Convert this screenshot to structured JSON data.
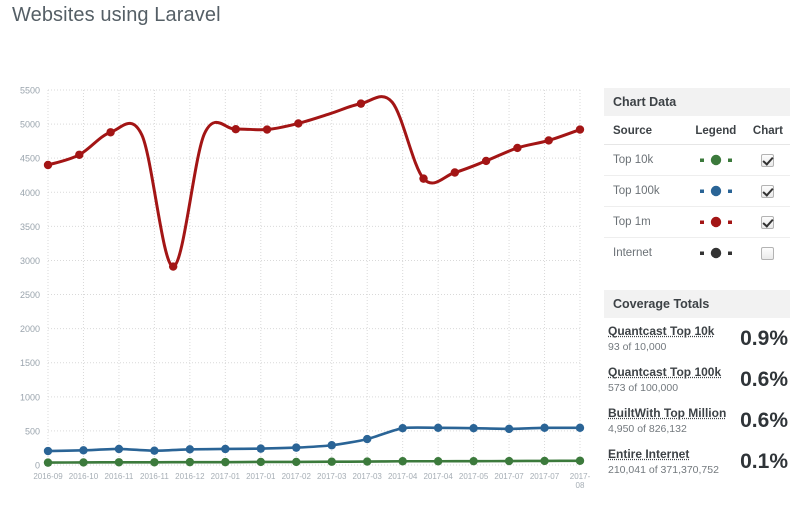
{
  "page_title": "Websites using Laravel",
  "chart_panel": {
    "colors": {
      "top10k": "#3c7a3c",
      "top100k": "#2a6496",
      "top1m": "#a31515",
      "internet": "#333333",
      "grid": "#dddddd",
      "axis_text": "#9aa4ad"
    }
  },
  "chart_data": {
    "type": "line",
    "title": "Websites using Laravel",
    "xlabel": "",
    "ylabel": "",
    "ylim": [
      0,
      5500
    ],
    "ytick_step": 500,
    "grid": true,
    "legend_position": "right-panel",
    "yticks": [
      0,
      500,
      1000,
      1500,
      2000,
      2500,
      3000,
      3500,
      4000,
      4500,
      5000,
      5500
    ],
    "categories": [
      "2016-09",
      "2016-10",
      "2016-11",
      "2016-11",
      "2016-12",
      "2017-01",
      "2017-01",
      "2017-02",
      "2017-03",
      "2017-03",
      "2017-03",
      "2017-04",
      "2017-04",
      "2017-05",
      "2017-07",
      "2017-07",
      "2017-08"
    ],
    "xtick_labels": [
      "2016-09",
      "2016-10",
      "2016-11",
      "2016-11",
      "2016-12",
      "2017-01",
      "2017-01",
      "2017-02",
      "2017-03",
      "2017-03",
      "2017-04",
      "2017-04",
      "2017-05",
      "2017-07",
      "2017-07",
      "2017-08"
    ],
    "series": [
      {
        "name": "Top 1m",
        "color": "#a31515",
        "visible": true,
        "values": [
          4400,
          4550,
          4880,
          4840,
          2910,
          4860,
          4925,
          4920,
          5010,
          5150,
          5300,
          5320,
          4200,
          4290,
          4460,
          4650,
          4760,
          4920
        ]
      },
      {
        "name": "Top 100k",
        "color": "#2a6496",
        "visible": true,
        "values": [
          205,
          215,
          235,
          210,
          230,
          235,
          240,
          255,
          290,
          380,
          540,
          545,
          540,
          530,
          545,
          545
        ]
      },
      {
        "name": "Top 10k",
        "color": "#3c7a3c",
        "visible": true,
        "values": [
          35,
          38,
          40,
          40,
          42,
          42,
          45,
          45,
          48,
          50,
          55,
          55,
          56,
          58,
          60,
          62
        ]
      },
      {
        "name": "Internet",
        "color": "#333333",
        "visible": false,
        "values": []
      }
    ]
  },
  "chart_data_panel": {
    "title": "Chart Data",
    "headers": {
      "source": "Source",
      "legend": "Legend",
      "chart": "Chart"
    },
    "rows": [
      {
        "source": "Top 10k",
        "color": "#3c7a3c",
        "checked": true
      },
      {
        "source": "Top 100k",
        "color": "#2a6496",
        "checked": true
      },
      {
        "source": "Top 1m",
        "color": "#a31515",
        "checked": true
      },
      {
        "source": "Internet",
        "color": "#333333",
        "checked": false
      }
    ]
  },
  "coverage_totals": {
    "title": "Coverage Totals",
    "rows": [
      {
        "label": "Quantcast Top 10k",
        "detail": "93 of 10,000",
        "percent": "0.9%"
      },
      {
        "label": "Quantcast Top 100k",
        "detail": "573 of 100,000",
        "percent": "0.6%"
      },
      {
        "label": "BuiltWith Top Million",
        "detail": "4,950 of 826,132",
        "percent": "0.6%"
      },
      {
        "label": "Entire Internet",
        "detail": "210,041 of 371,370,752",
        "percent": "0.1%"
      }
    ]
  }
}
